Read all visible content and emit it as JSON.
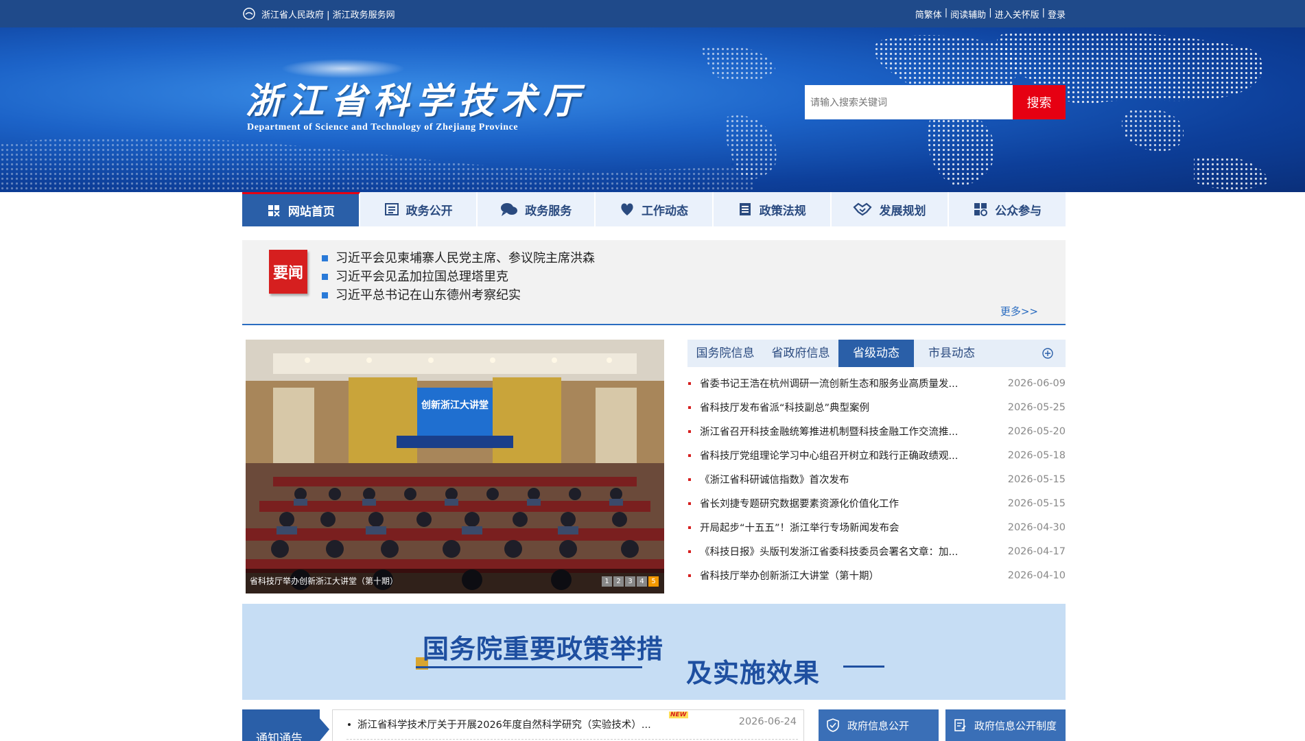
{
  "topbar": {
    "left_text": "浙江省人民政府 | 浙江政务服务网",
    "right_links": [
      "简繁体",
      "阅读辅助",
      "进入关怀版",
      "登录"
    ]
  },
  "banner": {
    "logo_cn": "浙江省科学技术厅",
    "logo_en": "Department of Science and Technology of Zhejiang Province",
    "search_placeholder": "请输入搜索关键词",
    "search_button": "搜索"
  },
  "nav": [
    {
      "label": "网站首页",
      "icon": "home-icon",
      "active": true
    },
    {
      "label": "政务公开",
      "icon": "list-icon",
      "active": false
    },
    {
      "label": "政务服务",
      "icon": "chat-icon",
      "active": false
    },
    {
      "label": "工作动态",
      "icon": "heart-icon",
      "active": false
    },
    {
      "label": "政策法规",
      "icon": "document-icon",
      "active": false
    },
    {
      "label": "发展规划",
      "icon": "handshake-icon",
      "active": false
    },
    {
      "label": "公众参与",
      "icon": "people-icon",
      "active": false
    }
  ],
  "headlines": {
    "badge": "要闻",
    "items": [
      "习近平会见柬埔寨人民党主席、参议院主席洪森",
      "习近平会见孟加拉国总理塔里克",
      "习近平总书记在山东德州考察纪实"
    ],
    "more": "更多>>"
  },
  "carousel": {
    "caption": "省科技厅举办创新浙江大讲堂（第十期）",
    "screen_text": "创新浙江大讲堂",
    "dots": [
      "1",
      "2",
      "3",
      "4",
      "5"
    ],
    "active_dot": 5
  },
  "news": {
    "tabs": [
      "国务院信息",
      "省政府信息",
      "省级动态",
      "市县动态"
    ],
    "active_tab": 2,
    "items": [
      {
        "title": "省委书记王浩在杭州调研一流创新生态和服务业高质量发...",
        "date": "2026-06-09"
      },
      {
        "title": "省科技厅发布省派“科技副总”典型案例",
        "date": "2026-05-25"
      },
      {
        "title": "浙江省召开科技金融统筹推进机制暨科技金融工作交流推...",
        "date": "2026-05-20"
      },
      {
        "title": "省科技厅党组理论学习中心组召开树立和践行正确政绩观...",
        "date": "2026-05-18"
      },
      {
        "title": "《浙江省科研诚信指数》首次发布",
        "date": "2026-05-15"
      },
      {
        "title": "省长刘捷专题研究数据要素资源化价值化工作",
        "date": "2026-05-15"
      },
      {
        "title": "开局起步“十五五”！浙江举行专场新闻发布会",
        "date": "2026-04-30"
      },
      {
        "title": "《科技日报》头版刊发浙江省委科技委员会署名文章：加...",
        "date": "2026-04-17"
      },
      {
        "title": "省科技厅举办创新浙江大讲堂（第十期）",
        "date": "2026-04-10"
      }
    ]
  },
  "policy_banner": {
    "line1": "国务院重要政策举措",
    "line2": "及实施效果"
  },
  "notice": {
    "tab": "通知通告",
    "item": "浙江省科学技术厅关于开展2026年度自然科学研究（实验技术）...",
    "badge": "NEW",
    "date": "2026-06-24"
  },
  "gov_buttons": [
    "政府信息公开",
    "政府信息公开制度"
  ],
  "colors": {
    "primary": "#2a5fa8",
    "accent": "#e60012",
    "topbar": "#1f4a8a"
  }
}
